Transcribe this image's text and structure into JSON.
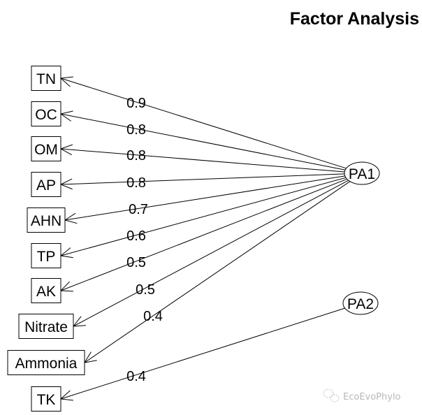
{
  "title": "Factor Analysis",
  "watermark": "EcoEvoPhylo",
  "latent_factors": [
    {
      "id": "PA1",
      "label": "PA1"
    },
    {
      "id": "PA2",
      "label": "PA2"
    }
  ],
  "observed_variables": [
    {
      "id": "TN",
      "label": "TN"
    },
    {
      "id": "OC",
      "label": "OC"
    },
    {
      "id": "OM",
      "label": "OM"
    },
    {
      "id": "AP",
      "label": "AP"
    },
    {
      "id": "AHN",
      "label": "AHN"
    },
    {
      "id": "TP",
      "label": "TP"
    },
    {
      "id": "AK",
      "label": "AK"
    },
    {
      "id": "Nitrate",
      "label": "Nitrate"
    },
    {
      "id": "Ammonia",
      "label": "Ammonia"
    },
    {
      "id": "TK",
      "label": "TK"
    }
  ],
  "loadings": [
    {
      "from": "PA1",
      "to": "TN",
      "value": "0.9"
    },
    {
      "from": "PA1",
      "to": "OC",
      "value": "0.8"
    },
    {
      "from": "PA1",
      "to": "OM",
      "value": "0.8"
    },
    {
      "from": "PA1",
      "to": "AP",
      "value": "0.8"
    },
    {
      "from": "PA1",
      "to": "AHN",
      "value": "0.7"
    },
    {
      "from": "PA1",
      "to": "TP",
      "value": "0.6"
    },
    {
      "from": "PA1",
      "to": "AK",
      "value": "0.5"
    },
    {
      "from": "PA1",
      "to": "Nitrate",
      "value": "0.5"
    },
    {
      "from": "PA1",
      "to": "Ammonia",
      "value": "0.4"
    },
    {
      "from": "PA2",
      "to": "TK",
      "value": "0.4"
    }
  ]
}
